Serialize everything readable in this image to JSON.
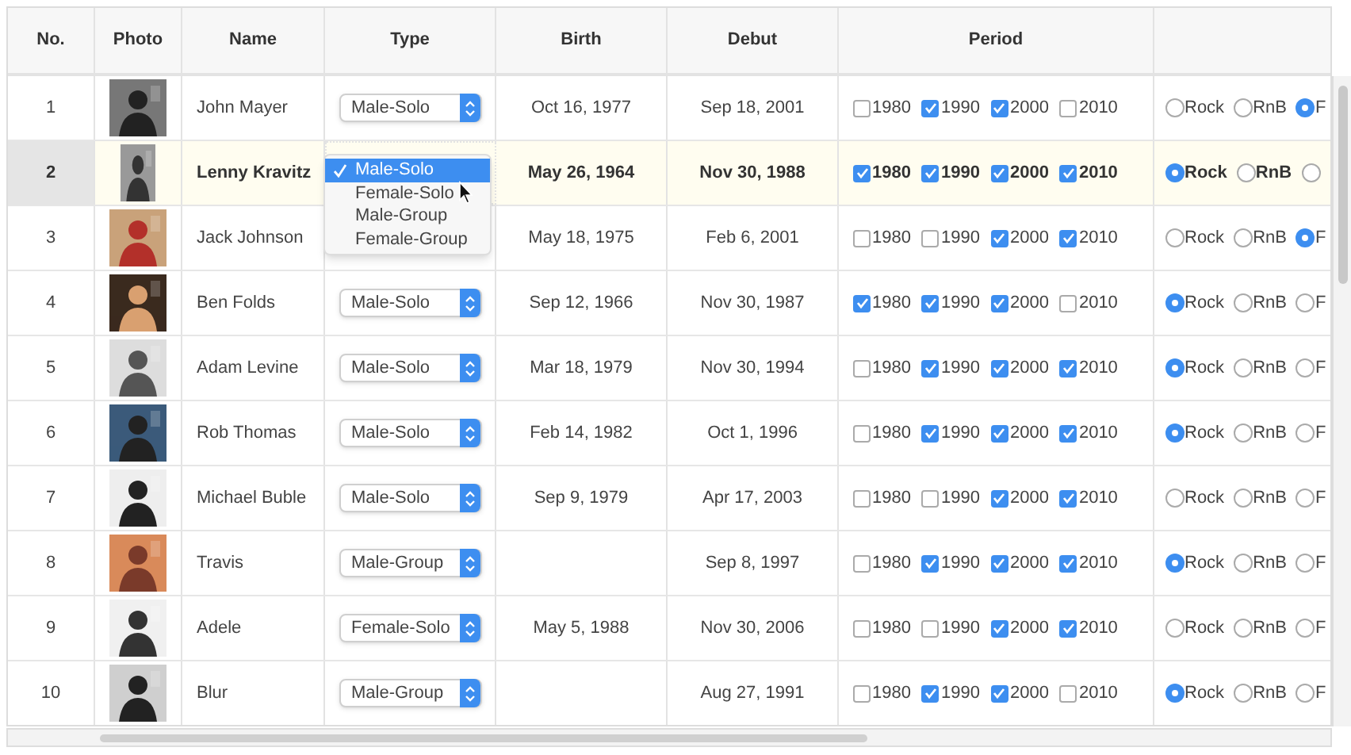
{
  "columns": [
    "No.",
    "Photo",
    "Name",
    "Type",
    "Birth",
    "Debut",
    "Period"
  ],
  "rows": [
    {
      "no": "1",
      "selected": false,
      "photo": {
        "kind": "picture"
      },
      "name": "John Mayer",
      "type": "Male-Solo",
      "birth": "Oct 16, 1977",
      "debut": "Sep 18, 2001",
      "period": [
        {
          "label": "1980",
          "checked": false
        },
        {
          "label": "1990",
          "checked": true
        },
        {
          "label": "2000",
          "checked": true
        },
        {
          "label": "2010",
          "checked": false
        }
      ],
      "genre": [
        {
          "label": "Rock",
          "selected": false
        },
        {
          "label": "RnB",
          "selected": false
        },
        {
          "label": "F",
          "selected": true
        }
      ]
    },
    {
      "no": "2",
      "selected": true,
      "photo": {
        "kind": "picture"
      },
      "name": "Lenny Kravitz",
      "type_dropdown": {
        "options": [
          {
            "label": "Male-Solo",
            "selected": true
          },
          {
            "label": "Female-Solo",
            "selected": false
          },
          {
            "label": "Male-Group",
            "selected": false
          },
          {
            "label": "Female-Group",
            "selected": false
          }
        ]
      },
      "birth": "May 26, 1964",
      "debut": "Nov 30, 1988",
      "period": [
        {
          "label": "1980",
          "checked": true
        },
        {
          "label": "1990",
          "checked": true
        },
        {
          "label": "2000",
          "checked": true
        },
        {
          "label": "2010",
          "checked": true
        }
      ],
      "genre": [
        {
          "label": "Rock",
          "selected": true
        },
        {
          "label": "RnB",
          "selected": false
        },
        {
          "selected": false
        }
      ]
    },
    {
      "no": "3",
      "selected": false,
      "photo": {
        "kind": "picture"
      },
      "name": "Jack Johnson",
      "birth": "May 18, 1975",
      "debut": "Feb 6, 2001",
      "period": [
        {
          "label": "1980",
          "checked": false
        },
        {
          "label": "1990",
          "checked": false
        },
        {
          "label": "2000",
          "checked": true
        },
        {
          "label": "2010",
          "checked": true
        }
      ],
      "genre": [
        {
          "label": "Rock",
          "selected": false
        },
        {
          "label": "RnB",
          "selected": false
        },
        {
          "label": "F",
          "selected": true
        }
      ]
    },
    {
      "no": "4",
      "selected": false,
      "photo": {
        "kind": "picture"
      },
      "name": "Ben Folds",
      "type": "Male-Solo",
      "birth": "Sep 12, 1966",
      "debut": "Nov 30, 1987",
      "period": [
        {
          "label": "1980",
          "checked": true
        },
        {
          "label": "1990",
          "checked": true
        },
        {
          "label": "2000",
          "checked": true
        },
        {
          "label": "2010",
          "checked": false
        }
      ],
      "genre": [
        {
          "label": "Rock",
          "selected": true
        },
        {
          "label": "RnB",
          "selected": false
        },
        {
          "label": "F",
          "selected": false
        }
      ]
    },
    {
      "no": "5",
      "selected": false,
      "photo": {
        "kind": "picture"
      },
      "name": "Adam Levine",
      "type": "Male-Solo",
      "birth": "Mar 18, 1979",
      "debut": "Nov 30, 1994",
      "period": [
        {
          "label": "1980",
          "checked": false
        },
        {
          "label": "1990",
          "checked": true
        },
        {
          "label": "2000",
          "checked": true
        },
        {
          "label": "2010",
          "checked": true
        }
      ],
      "genre": [
        {
          "label": "Rock",
          "selected": true
        },
        {
          "label": "RnB",
          "selected": false
        },
        {
          "label": "F",
          "selected": false
        }
      ]
    },
    {
      "no": "6",
      "selected": false,
      "photo": {
        "kind": "picture"
      },
      "name": "Rob Thomas",
      "type": "Male-Solo",
      "birth": "Feb 14, 1982",
      "debut": "Oct 1, 1996",
      "period": [
        {
          "label": "1980",
          "checked": false
        },
        {
          "label": "1990",
          "checked": true
        },
        {
          "label": "2000",
          "checked": true
        },
        {
          "label": "2010",
          "checked": true
        }
      ],
      "genre": [
        {
          "label": "Rock",
          "selected": true
        },
        {
          "label": "RnB",
          "selected": false
        },
        {
          "label": "F",
          "selected": false
        }
      ]
    },
    {
      "no": "7",
      "selected": false,
      "photo": {
        "kind": "picture"
      },
      "name": "Michael Buble",
      "type": "Male-Solo",
      "birth": "Sep 9, 1979",
      "debut": "Apr 17, 2003",
      "period": [
        {
          "label": "1980",
          "checked": false
        },
        {
          "label": "1990",
          "checked": false
        },
        {
          "label": "2000",
          "checked": true
        },
        {
          "label": "2010",
          "checked": true
        }
      ],
      "genre": [
        {
          "label": "Rock",
          "selected": false
        },
        {
          "label": "RnB",
          "selected": false
        },
        {
          "label": "F",
          "selected": false
        }
      ]
    },
    {
      "no": "8",
      "selected": false,
      "photo": {
        "kind": "picture"
      },
      "name": "Travis",
      "type": "Male-Group",
      "debut": "Sep 8, 1997",
      "period": [
        {
          "label": "1980",
          "checked": false
        },
        {
          "label": "1990",
          "checked": true
        },
        {
          "label": "2000",
          "checked": true
        },
        {
          "label": "2010",
          "checked": true
        }
      ],
      "genre": [
        {
          "label": "Rock",
          "selected": true
        },
        {
          "label": "RnB",
          "selected": false
        },
        {
          "label": "F",
          "selected": false
        }
      ]
    },
    {
      "no": "9",
      "selected": false,
      "photo": {
        "kind": "picture"
      },
      "name": "Adele",
      "type": "Female-Solo",
      "birth": "May 5, 1988",
      "debut": "Nov 30, 2006",
      "period": [
        {
          "label": "1980",
          "checked": false
        },
        {
          "label": "1990",
          "checked": false
        },
        {
          "label": "2000",
          "checked": true
        },
        {
          "label": "2010",
          "checked": true
        }
      ],
      "genre": [
        {
          "label": "Rock",
          "selected": false
        },
        {
          "label": "RnB",
          "selected": false
        },
        {
          "label": "F",
          "selected": false
        }
      ]
    },
    {
      "no": "10",
      "selected": false,
      "photo": {
        "kind": "picture"
      },
      "name": "Blur",
      "type": "Male-Group",
      "debut": "Aug 27, 1991",
      "period": [
        {
          "label": "1980",
          "checked": false
        },
        {
          "label": "1990",
          "checked": true
        },
        {
          "label": "2000",
          "checked": true
        },
        {
          "label": "2010",
          "checked": false
        }
      ],
      "genre": [
        {
          "label": "Rock",
          "selected": true
        },
        {
          "label": "RnB",
          "selected": false
        },
        {
          "label": "F",
          "selected": false
        }
      ]
    }
  ]
}
